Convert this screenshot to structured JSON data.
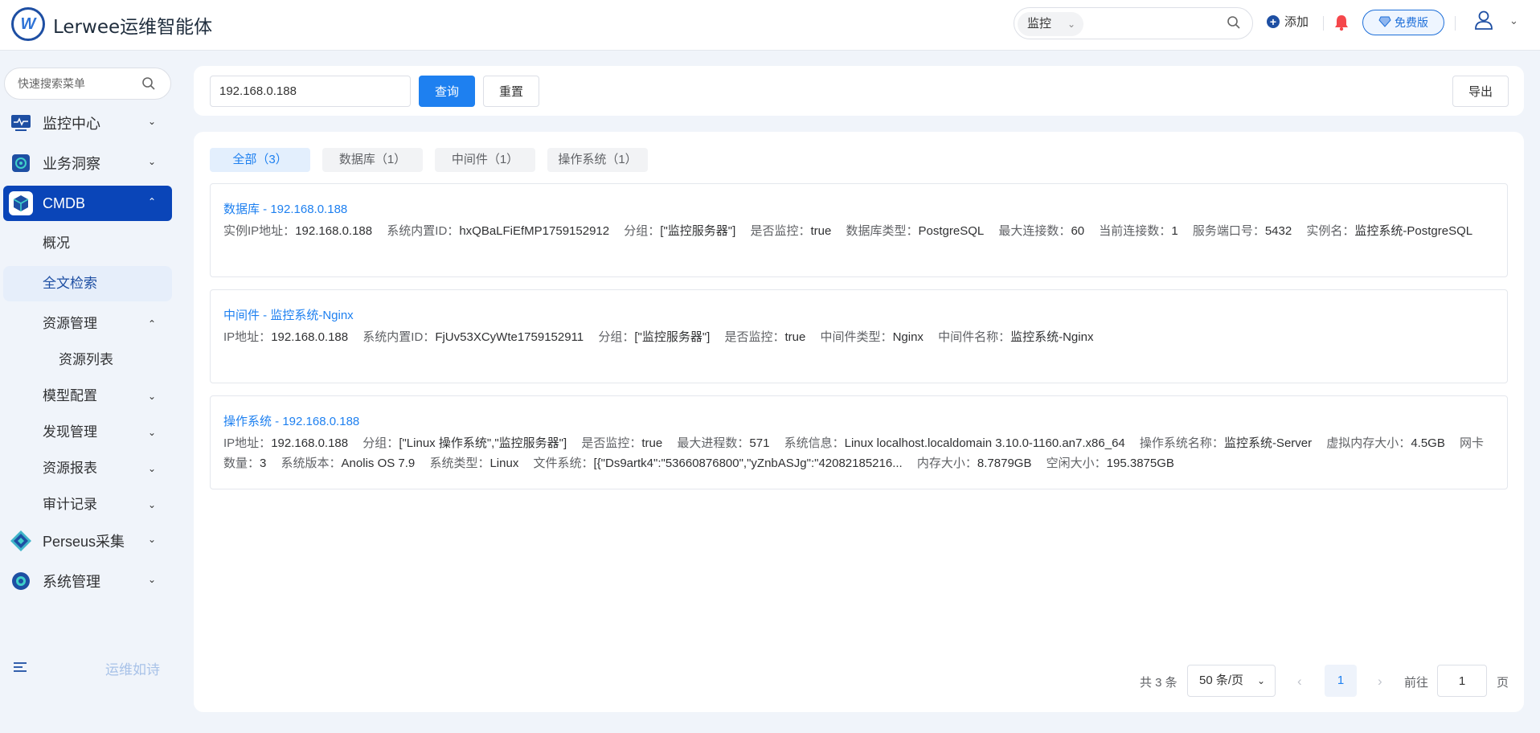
{
  "header": {
    "logo_letter": "W",
    "app_title": "Lerwee运维智能体",
    "search_scope": "监控",
    "add_label": "添加",
    "free_label": "免费版"
  },
  "sidebar": {
    "search_placeholder": "快速搜索菜单",
    "items": [
      {
        "label": "监控中心"
      },
      {
        "label": "业务洞察"
      },
      {
        "label": "CMDB"
      },
      {
        "label": "概况"
      },
      {
        "label": "全文检索"
      },
      {
        "label": "资源管理"
      },
      {
        "label": "资源列表"
      },
      {
        "label": "模型配置"
      },
      {
        "label": "发现管理"
      },
      {
        "label": "资源报表"
      },
      {
        "label": "审计记录"
      },
      {
        "label": "Perseus采集"
      },
      {
        "label": "系统管理"
      }
    ],
    "footer_text": "运维如诗"
  },
  "filter": {
    "ip_value": "192.168.0.188",
    "query_label": "查询",
    "reset_label": "重置",
    "export_label": "导出"
  },
  "tabs": [
    {
      "label": "全部（3）"
    },
    {
      "label": "数据库（1）"
    },
    {
      "label": "中间件（1）"
    },
    {
      "label": "操作系统（1）"
    }
  ],
  "cards": [
    {
      "title": "数据库 - 192.168.0.188",
      "fields": [
        {
          "k": "实例IP地址：",
          "v": "192.168.0.188"
        },
        {
          "k": "系统内置ID：",
          "v": "hxQBaLFiEfMP1759152912"
        },
        {
          "k": "分组：",
          "v": "[\"监控服务器\"]"
        },
        {
          "k": "是否监控：",
          "v": "true"
        },
        {
          "k": "数据库类型：",
          "v": "PostgreSQL"
        },
        {
          "k": "最大连接数：",
          "v": "60"
        },
        {
          "k": "当前连接数：",
          "v": "1"
        },
        {
          "k": "服务端口号：",
          "v": "5432"
        },
        {
          "k": "实例名：",
          "v": "监控系统-PostgreSQL"
        }
      ]
    },
    {
      "title": "中间件 - 监控系统-Nginx",
      "fields": [
        {
          "k": "IP地址：",
          "v": "192.168.0.188"
        },
        {
          "k": "系统内置ID：",
          "v": "FjUv53XCyWte1759152911"
        },
        {
          "k": "分组：",
          "v": "[\"监控服务器\"]"
        },
        {
          "k": "是否监控：",
          "v": "true"
        },
        {
          "k": "中间件类型：",
          "v": "Nginx"
        },
        {
          "k": "中间件名称：",
          "v": "监控系统-Nginx"
        }
      ]
    },
    {
      "title": "操作系统 - 192.168.0.188",
      "fields": [
        {
          "k": "IP地址：",
          "v": "192.168.0.188"
        },
        {
          "k": "分组：",
          "v": "[\"Linux 操作系统\",\"监控服务器\"]"
        },
        {
          "k": "是否监控：",
          "v": "true"
        },
        {
          "k": "最大进程数：",
          "v": "571"
        },
        {
          "k": "系统信息：",
          "v": "Linux localhost.localdomain 3.10.0-1160.an7.x86_64"
        },
        {
          "k": "操作系统名称：",
          "v": "监控系统-Server"
        },
        {
          "k": "虚拟内存大小：",
          "v": "4.5GB"
        },
        {
          "k": "网卡数量：",
          "v": "3"
        },
        {
          "k": "系统版本：",
          "v": "Anolis OS 7.9"
        },
        {
          "k": "系统类型：",
          "v": "Linux"
        },
        {
          "k": "文件系统：",
          "v": "[{\"Ds9artk4\":\"53660876800\",\"yZnbASJg\":\"42082185216..."
        },
        {
          "k": "内存大小：",
          "v": "8.7879GB"
        },
        {
          "k": "空闲大小：",
          "v": "195.3875GB"
        }
      ]
    }
  ],
  "pagination": {
    "total": "共 3 条",
    "page_size": "50 条/页",
    "current_page": "1",
    "goto_label": "前往",
    "goto_value": "1",
    "page_suffix": "页"
  },
  "colors": {
    "accent": "#1e80f0",
    "sidebar_active": "#0a45b8"
  }
}
